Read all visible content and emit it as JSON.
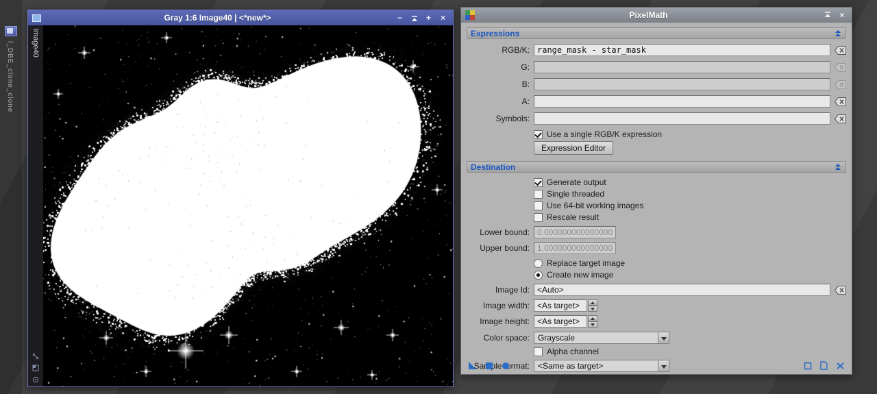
{
  "workspace": {
    "iconized_tab_label": "l_DBE_clone_clone"
  },
  "image_window": {
    "title": "Gray 1:6 Image40 | <*new*>",
    "tab_label": "Image40",
    "icons": {
      "iconize": "−",
      "zoom": "+",
      "close": "×"
    }
  },
  "pixelmath": {
    "title": "PixelMath",
    "window_icons": {
      "close": "×"
    },
    "sections": {
      "expressions": "Expressions",
      "destination": "Destination"
    },
    "fields": {
      "rgbk": {
        "label": "RGB/K:",
        "value": "range_mask - star_mask"
      },
      "g": {
        "label": "G:",
        "value": ""
      },
      "b": {
        "label": "B:",
        "value": ""
      },
      "a": {
        "label": "A:",
        "value": ""
      },
      "symbols": {
        "label": "Symbols:",
        "value": ""
      },
      "lower_bound": {
        "label": "Lower bound:",
        "value": "0.000000000000000"
      },
      "upper_bound": {
        "label": "Upper bound:",
        "value": "1.000000000000000"
      },
      "image_id": {
        "label": "Image Id:",
        "value": "<Auto>"
      },
      "image_width": {
        "label": "Image width:",
        "value": "<As target>"
      },
      "image_height": {
        "label": "Image height:",
        "value": "<As target>"
      },
      "color_space": {
        "label": "Color space:",
        "value": "Grayscale"
      },
      "sample_format": {
        "label": "Sample format:",
        "value": "<Same as target>"
      }
    },
    "checkboxes": {
      "single_rgbk": {
        "label": "Use a single RGB/K expression",
        "checked": true
      },
      "generate_output": {
        "label": "Generate output",
        "checked": true
      },
      "single_threaded": {
        "label": "Single threaded",
        "checked": false
      },
      "use_64bit": {
        "label": "Use 64-bit working images",
        "checked": false
      },
      "rescale_result": {
        "label": "Rescale result",
        "checked": false
      },
      "alpha_channel": {
        "label": "Alpha channel",
        "checked": false
      }
    },
    "radios": {
      "replace_target": {
        "label": "Replace target image",
        "selected": false
      },
      "create_new": {
        "label": "Create new image",
        "selected": true
      }
    },
    "buttons": {
      "expression_editor": "Expression Editor"
    },
    "accent_color": "#1a55c0"
  }
}
